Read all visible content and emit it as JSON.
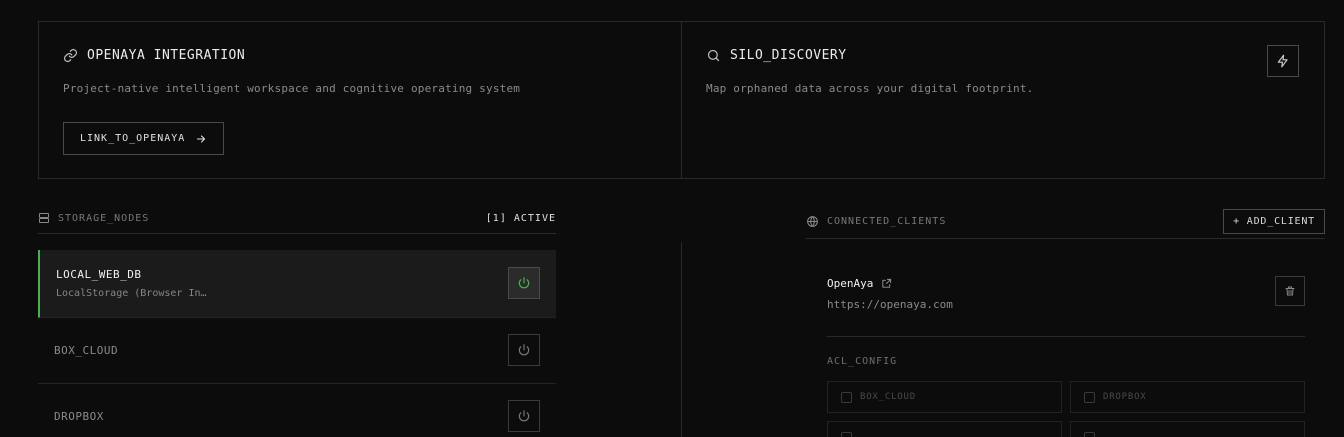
{
  "integration": {
    "title": "OPENAYA INTEGRATION",
    "description": "Project-native intelligent workspace and cognitive operating system",
    "link_button": "LINK_TO_OPENAYA",
    "icon": "link-icon"
  },
  "discovery": {
    "title": "SILO_DISCOVERY",
    "description": "Map orphaned data across your digital footprint.",
    "icon": "search-icon",
    "action_icon": "bolt-icon"
  },
  "storage": {
    "label": "STORAGE_NODES",
    "active_count": "[1] ACTIVE",
    "nodes": [
      {
        "name": "LOCAL_WEB_DB",
        "subtitle": "LocalStorage (Browser In…",
        "active": true
      },
      {
        "name": "BOX_CLOUD",
        "active": false
      },
      {
        "name": "DROPBOX",
        "active": false
      }
    ]
  },
  "clients": {
    "label": "CONNECTED_CLIENTS",
    "add_button": "+ ADD_CLIENT",
    "items": [
      {
        "name": "OpenAya",
        "url": "https://openaya.com",
        "acl_label": "ACL_CONFIG",
        "acl_options": [
          "BOX_CLOUD",
          "DROPBOX",
          "",
          ""
        ]
      }
    ]
  },
  "colors": {
    "accent": "#4caf50",
    "background": "#0c0c0c",
    "border": "#2a2a2a"
  }
}
